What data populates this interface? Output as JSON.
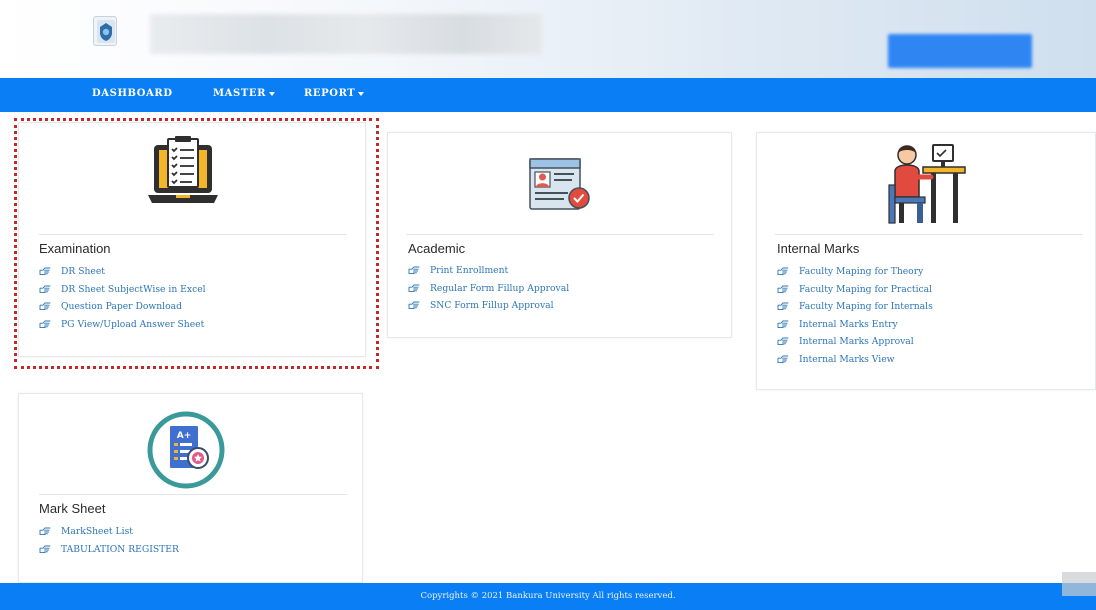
{
  "nav": {
    "dashboard": "DASHBOARD",
    "master": "MASTER",
    "report": "REPORT"
  },
  "cards": {
    "examination": {
      "title": "Examination",
      "links": [
        "DR Sheet",
        "DR Sheet SubjectWise in Excel",
        "Question Paper Download",
        "PG View/Upload Answer Sheet"
      ]
    },
    "academic": {
      "title": "Academic",
      "links": [
        "Print Enrollment",
        "Regular Form Fillup Approval",
        "SNC Form Fillup Approval"
      ]
    },
    "internal_marks": {
      "title": "Internal Marks",
      "links": [
        "Faculty Maping for Theory",
        "Faculty Maping for Practical",
        "Faculty Maping for Internals",
        "Internal Marks Entry",
        "Internal Marks Approval",
        "Internal Marks View"
      ]
    },
    "mark_sheet": {
      "title": "Mark Sheet",
      "links": [
        "MarkSheet List",
        "TABULATION REGISTER"
      ],
      "badge": "A+"
    }
  },
  "footer": {
    "copyright": "Copyrights © 2021 Bankura University All rights reserved."
  },
  "colors": {
    "navbar": "#0a7ff5",
    "link": "#2c76b6",
    "highlight": "#c22a2a"
  },
  "icons": {
    "link_bullet": "hand-point-right-icon",
    "examination": "laptop-checklist-icon",
    "academic": "id-card-icon",
    "internal_marks": "person-at-desk-icon",
    "mark_sheet": "grade-sheet-icon"
  }
}
